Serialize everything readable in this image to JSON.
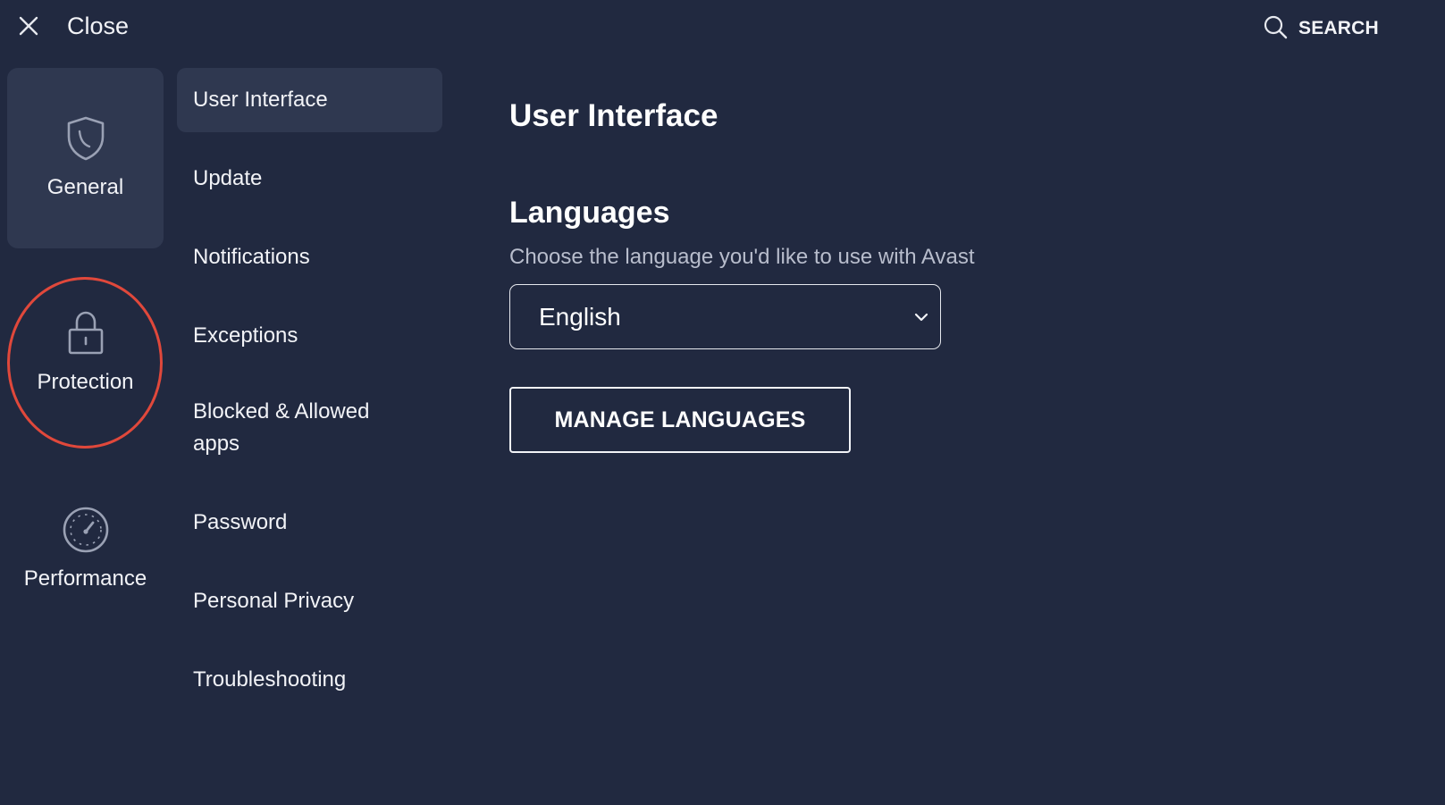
{
  "topbar": {
    "close_label": "Close",
    "close_icon": "close-icon",
    "search_label": "SEARCH",
    "search_icon": "search-icon"
  },
  "categories": [
    {
      "label": "General",
      "icon": "shield-icon",
      "active": true
    },
    {
      "label": "Protection",
      "icon": "lock-icon",
      "active": false
    },
    {
      "label": "Performance",
      "icon": "speedometer-icon",
      "active": false
    }
  ],
  "submenu": [
    {
      "label": "User Interface",
      "active": true
    },
    {
      "label": "Update"
    },
    {
      "label": "Notifications"
    },
    {
      "label": "Exceptions"
    },
    {
      "label": "Blocked & Allowed apps"
    },
    {
      "label": "Password"
    },
    {
      "label": "Personal Privacy"
    },
    {
      "label": "Troubleshooting"
    }
  ],
  "main": {
    "title": "User Interface",
    "languages": {
      "heading": "Languages",
      "description": "Choose the language you'd like to use with Avast",
      "selected_language": "English",
      "dropdown_icon": "chevron-down-icon",
      "manage_button": "MANAGE LANGUAGES"
    }
  },
  "colors": {
    "background": "#212940",
    "active_item": "#2f3850",
    "highlight_ring": "#e0483b",
    "text": "#f2f3f7",
    "muted_text": "#b8bdcc"
  }
}
